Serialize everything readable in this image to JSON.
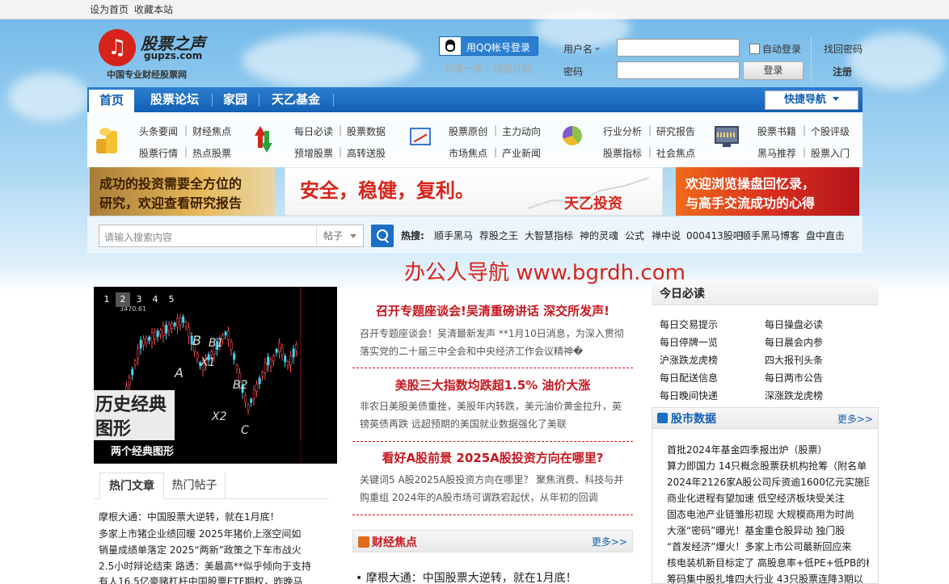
{
  "topbar": {
    "set_home": "设为首页",
    "bookmark": "收藏本站"
  },
  "logo": {
    "cn": "股票之声",
    "en": "gupzs.com",
    "subtitle": "中国专业财经股票网"
  },
  "login": {
    "qq_button": "用QQ帐号登录",
    "qq_tip": "只需一步，快速开始",
    "username_label": "用户名",
    "password_label": "密码",
    "auto_login": "自动登录",
    "find_password": "找回密码",
    "login_button": "登录",
    "register": "注册"
  },
  "nav": {
    "tabs": [
      "首页",
      "股票论坛",
      "家园",
      "天乙基金"
    ],
    "quick_nav": "快捷导航"
  },
  "menu": {
    "groups": [
      {
        "icon": "coins-icon",
        "links": [
          "头条要闻",
          "财经焦点",
          "股票行情",
          "热点股票"
        ]
      },
      {
        "icon": "arrows-icon",
        "links": [
          "每日必读",
          "股票数据",
          "预增股票",
          "高转送股"
        ]
      },
      {
        "icon": "chart-icon",
        "links": [
          "股票原创",
          "主力动向",
          "市场焦点",
          "产业新闻"
        ]
      },
      {
        "icon": "pie-icon",
        "links": [
          "行业分析",
          "研究报告",
          "股票指标",
          "社会焦点"
        ]
      },
      {
        "icon": "monitor-icon",
        "links": [
          "股票书籍",
          "个股评级",
          "黑马推荐",
          "股票入门"
        ]
      }
    ]
  },
  "banners": {
    "left": [
      "成功的投资需要全方位的",
      "研究，欢迎查看研究报告"
    ],
    "mid": [
      "安全，稳健，复利。",
      "天乙投资"
    ],
    "right": [
      "欢迎浏览操盘回忆录，",
      "与高手交流成功的心得"
    ]
  },
  "search": {
    "placeholder": "请输入搜索内容",
    "category": "帖子",
    "hot_label": "热搜:",
    "hot_links": [
      "顺手黑马",
      "荐股之王",
      "大智慧指标",
      "神的灵魂",
      "公式",
      "禅中说",
      "000413股吧",
      "顺手黑马博客",
      "盘中直击"
    ]
  },
  "watermark": "办公人导航 www.bgrdh.com",
  "slideshow": {
    "numbers": [
      "1",
      "2",
      "3",
      "4",
      "5"
    ],
    "active_index": 2,
    "caption": "两个经典图形",
    "overlay": [
      "历史经典",
      "图形"
    ],
    "chart_labels": [
      "A",
      "B",
      "X1",
      "B1",
      "X2",
      "B2",
      "C",
      "3470.61"
    ]
  },
  "tabs": {
    "hot_articles": "热门文章",
    "hot_posts": "热门帖子"
  },
  "hot_articles": [
    "摩根大通：中国股票大逆转，就在1月底！",
    "多家上市猪企业绩回暖 2025年猪价上涨空间如",
    "销量成绩单落定 2025“两新”政策之下车市战火",
    "2.5小时辩论结束 路透：美最高**似乎倾向于支持",
    "有人16.5亿豪赌杠杆中国股票ETF期权，昨晚马"
  ],
  "news": [
    {
      "title": "召开专题座谈会!吴清重磅讲话 深交所发声!",
      "body": "召开专题座谈会！吴清最新发声 **1月10日消息，为深入贯彻落实党的二十届三中全会和中央经济工作会议精神�"
    },
    {
      "title": "美股三大指数均跌超1.5% 油价大涨",
      "body": "非农日美股美债重挫，美股年内转跌，美元油价黄金拉升，英镑英债再跌 远超预期的美国就业数据强化了美联"
    },
    {
      "title": "看好A股前景 2025A股投资方向在哪里?",
      "body": "关键词5 A股2025A股投资方向在哪里？ 聚焦消费、科技与并购重组 2024年的A股市场可谓跌宕起伏，从年初的回调"
    }
  ],
  "finance_focus": {
    "title": "财经焦点",
    "more": "更多>>",
    "first": "摩根大通：中国股票大逆转，就在1月底！"
  },
  "must_read": {
    "title": "今日必读",
    "links": [
      "每日交易提示",
      "每日操盘必读",
      "每日停牌一览",
      "每日晨会内参",
      "沪涨跌龙虎榜",
      "四大报刊头条",
      "每日配送信息",
      "每日两市公告",
      "每日晚间快递",
      "深涨跌龙虎榜"
    ]
  },
  "market_data": {
    "title": "股市数据",
    "more": "更多>>",
    "items": [
      "首批2024年基金四季报出炉（股票）",
      "算力即国力 14只概念股票获机构抢筹（附名单",
      "2024年2126家A股公司斥资逾1600亿元实施回购",
      "商业化进程有望加速 低空经济板块受关注",
      "固态电池产业链雏形初现 大规模商用为时尚",
      "大涨“密码”曝光！基金重仓股异动 独门股",
      "“首发经济”爆火！多家上市公司最新回应来",
      "核电装机新目标定了 高股息率+低PE+低PB的概",
      "筹码集中股扎堆四大行业 43只股票连降3期以"
    ]
  }
}
